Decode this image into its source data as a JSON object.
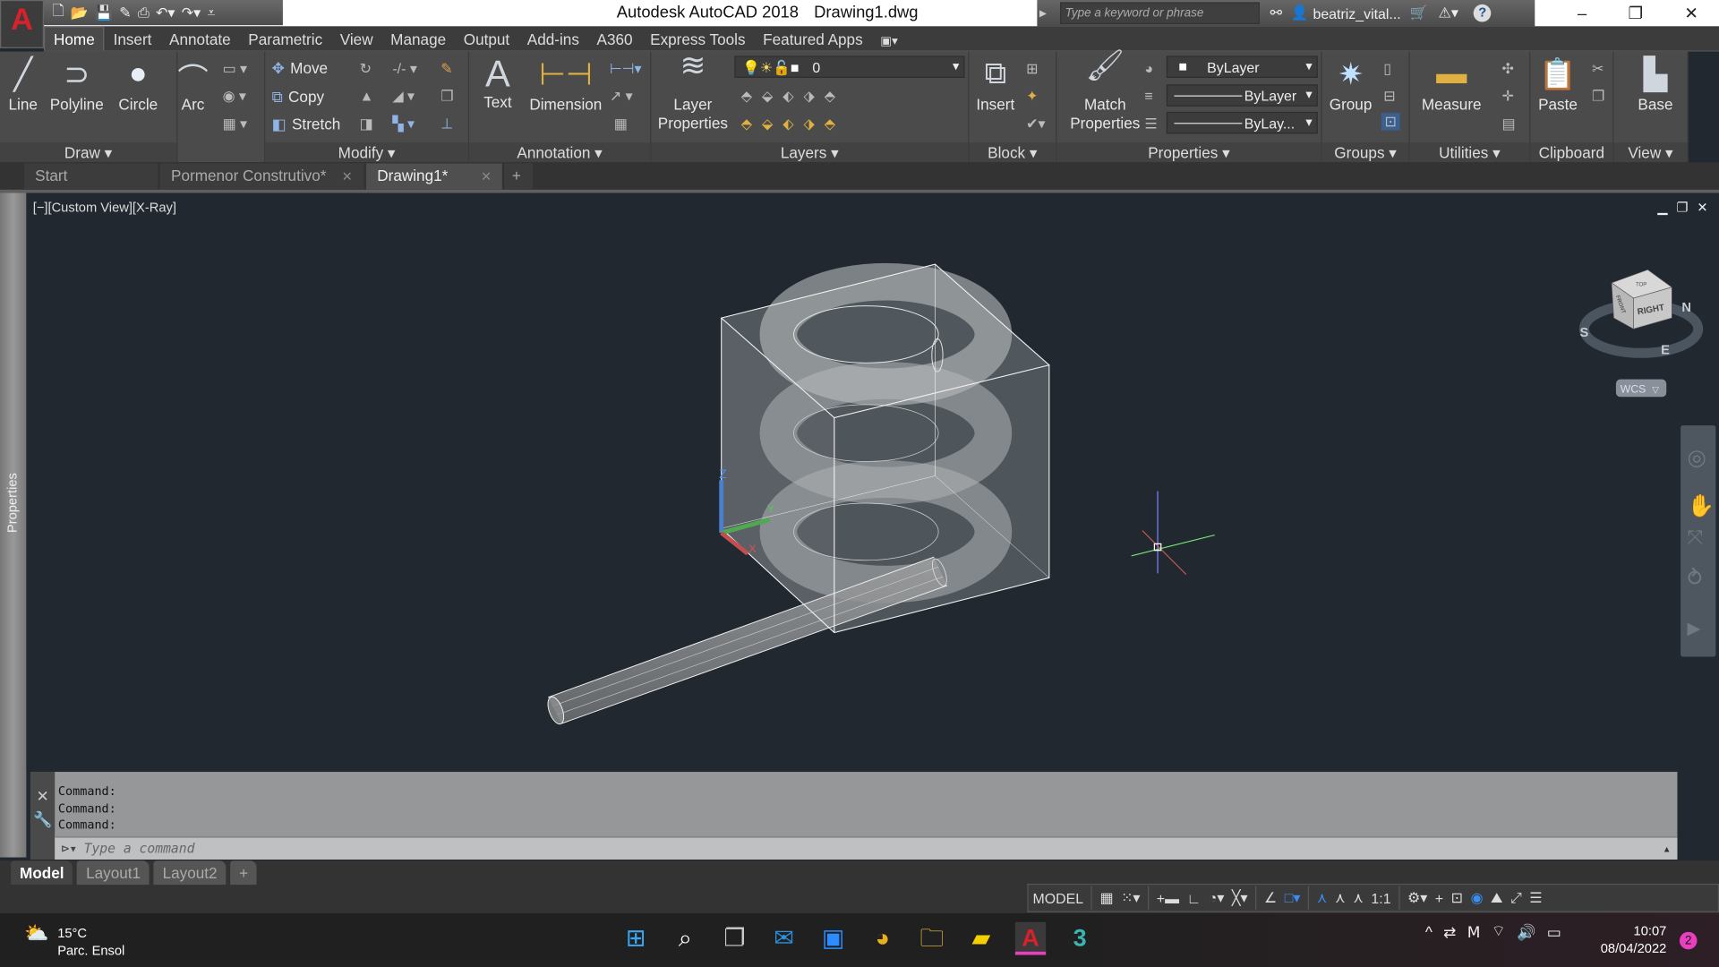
{
  "app": {
    "logo_letter": "A",
    "title": "Autodesk AutoCAD 2018",
    "document": "Drawing1.dwg"
  },
  "qat": {
    "icons": [
      "new-icon",
      "open-icon",
      "save-icon",
      "saveas-icon",
      "plot-icon",
      "undo-icon",
      "redo-icon",
      "customize-icon"
    ]
  },
  "infocenter": {
    "search_placeholder": "Type a keyword or phrase",
    "user": "beatriz_vital...",
    "help": "?"
  },
  "window": {
    "minimize": "–",
    "restore": "❐",
    "close": "✕"
  },
  "ribbon_tabs": [
    "Home",
    "Insert",
    "Annotate",
    "Parametric",
    "View",
    "Manage",
    "Output",
    "Add-ins",
    "A360",
    "Express Tools",
    "Featured Apps"
  ],
  "ribbon": {
    "draw": {
      "label": "Draw",
      "line": "Line",
      "polyline": "Polyline",
      "circle": "Circle",
      "arc": "Arc"
    },
    "modify": {
      "label": "Modify",
      "move": "Move",
      "copy": "Copy",
      "stretch": "Stretch"
    },
    "annotation": {
      "label": "Annotation",
      "text": "Text",
      "dimension": "Dimension"
    },
    "layers": {
      "label": "Layers",
      "layer_properties": "Layer Properties",
      "current_layer": "0"
    },
    "block": {
      "label": "Block",
      "insert": "Insert"
    },
    "properties": {
      "label": "Properties",
      "match": "Match Properties",
      "color": "ByLayer",
      "linetype": "ByLayer",
      "lineweight": "ByLay..."
    },
    "groups": {
      "label": "Groups",
      "group": "Group"
    },
    "utilities": {
      "label": "Utilities",
      "measure": "Measure"
    },
    "clipboard": {
      "label": "Clipboard",
      "paste": "Paste"
    },
    "view": {
      "label": "View",
      "base": "Base"
    }
  },
  "file_tabs": [
    {
      "label": "Start"
    },
    {
      "label": "Pormenor Construtivo*"
    },
    {
      "label": "Drawing1*",
      "active": true
    }
  ],
  "viewport": {
    "label": "[−][Custom View][X-Ray]",
    "viewcube_face": "RIGHT",
    "viewcube_top": "TOP",
    "viewcube_front": "FRONT",
    "compass": [
      "N",
      "E",
      "S"
    ],
    "ucs": "WCS",
    "ucs_axes": [
      "X",
      "Y",
      "Z"
    ]
  },
  "properties_palette": "Properties",
  "command": {
    "history": [
      "Command:",
      "Command:",
      "Command:"
    ],
    "placeholder": "Type a command"
  },
  "layout_tabs": [
    "Model",
    "Layout1",
    "Layout2"
  ],
  "status": {
    "space": "MODEL",
    "scale": "1:1"
  },
  "taskbar": {
    "temperature": "15°C",
    "weather": "Parc. Ensol",
    "time": "10:07",
    "date": "08/04/2022",
    "notifications": "2"
  },
  "colors": {
    "viewport_bg": "#212830",
    "autocad_red": "#d8212b",
    "x_axis": "#e05050",
    "y_axis": "#50c850",
    "z_axis": "#4a7fd0"
  }
}
